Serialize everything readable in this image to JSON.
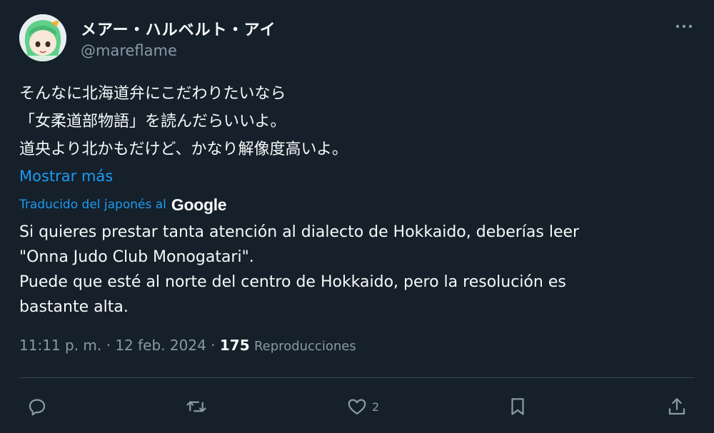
{
  "author": {
    "display_name": "メアー・ハルベルト・アイ",
    "handle": "@mareflame"
  },
  "tweet": {
    "lines": [
      "そんなに北海道弁にこだわりたいなら",
      "「女柔道部物語」を読んだらいいよ。",
      "道央より北かもだけど、かなり解像度高いよ。"
    ],
    "show_more": "Mostrar más"
  },
  "translation": {
    "label": "Traducido del japonés al",
    "provider": "Google",
    "lines": [
      "Si quieres prestar tanta atención al dialecto de Hokkaido, deberías leer",
      "\"Onna Judo Club Monogatari\".",
      "Puede que esté al norte del centro de Hokkaido, pero la resolución es",
      "bastante alta."
    ]
  },
  "meta": {
    "time": "11:11 p. m.",
    "separator": "·",
    "date": "12 feb. 2024",
    "views_count": "175",
    "views_label": "Reproducciones"
  },
  "actions": {
    "reply_icon": "speech-bubble-icon",
    "retweet_icon": "retweet-icon",
    "like_icon": "heart-icon",
    "like_count": "2",
    "bookmark_icon": "bookmark-icon",
    "share_icon": "share-icon"
  },
  "colors": {
    "background": "#15202b",
    "text": "#f7f9f9",
    "secondary": "#8b98a5",
    "accent": "#1d9bf0",
    "divider": "#38444d"
  }
}
